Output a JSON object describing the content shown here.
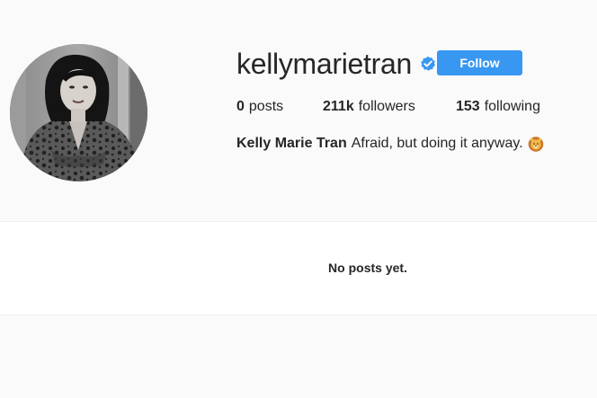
{
  "profile": {
    "username": "kellymarietran",
    "verified": true,
    "follow_label": "Follow",
    "stats": {
      "posts_count": "0",
      "posts_label": "posts",
      "followers_count": "211k",
      "followers_label": "followers",
      "following_count": "153",
      "following_label": "following"
    },
    "full_name": "Kelly Marie Tran",
    "bio": "Afraid, but doing it anyway.",
    "bio_emoji": "lion-face-emoji"
  },
  "content": {
    "empty_message": "No posts yet."
  },
  "colors": {
    "background": "#fafafa",
    "accent": "#3897f0",
    "text": "#262626",
    "panel": "#ffffff"
  }
}
